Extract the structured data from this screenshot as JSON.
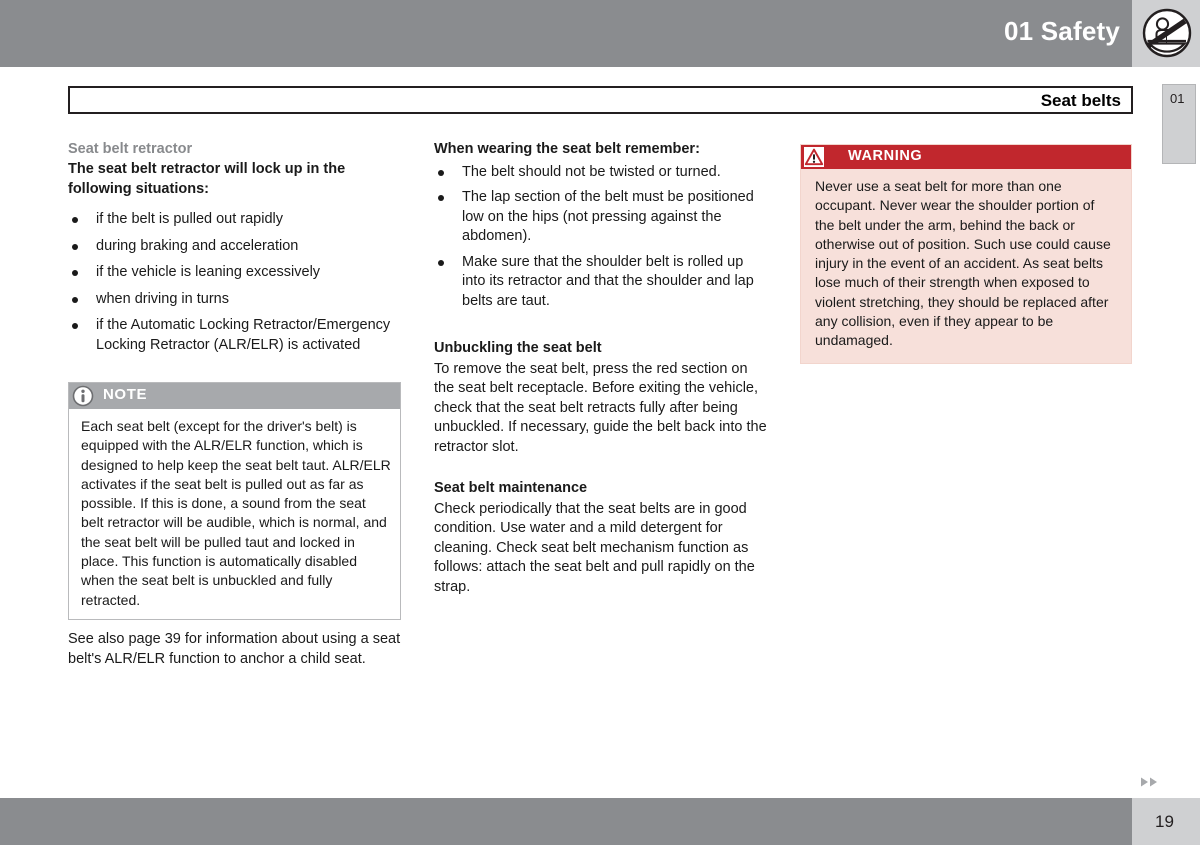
{
  "header": {
    "chapter_title": "01 Safety",
    "icon": "seat-belt-icon",
    "accent_gray": "#8a8c8f",
    "tab_gray": "#cfd0d2"
  },
  "section": {
    "title": "Seat belts",
    "chapter_tab": "01"
  },
  "columns": {
    "left": {
      "sub_heading": "Seat belt retractor",
      "lead": "The seat belt retractor will lock up in the following situations:",
      "bullets": [
        "if the belt is pulled out rapidly",
        "during braking and acceleration",
        "if the vehicle is leaning excessively",
        "when driving in turns",
        "if the Automatic Locking Retractor/Emergency Locking Retractor (ALR/ELR) is activated"
      ],
      "after_note_text": "See also page 39 for information about using a seat belt's ALR/ELR function to anchor a child seat."
    },
    "middle": {
      "bullet_heading": "When wearing the seat belt remember:",
      "bullets": [
        "The belt should not be twisted or turned.",
        "The lap section of the belt must be positioned low on the hips (not pressing against the abdomen).",
        "Make sure that the shoulder belt is rolled up into its retractor and that the shoulder and lap belts are taut."
      ],
      "sections": [
        {
          "heading": "Unbuckling the seat belt",
          "body": "To remove the seat belt, press the red section on the seat belt receptacle. Before exiting the vehicle, check that the seat belt retracts fully after being unbuckled. If necessary, guide the belt back into the retractor slot."
        },
        {
          "heading": "Seat belt maintenance",
          "body": "Check periodically that the seat belts are in good condition. Use water and a mild detergent for cleaning. Check seat belt mechanism function as follows: attach the seat belt and pull rapidly on the strap."
        }
      ]
    }
  },
  "note_box": {
    "label": "NOTE",
    "icon": "info-icon",
    "header_color": "#a7a9ac",
    "body": "Each seat belt (except for the driver's belt) is equipped with the ALR/ELR function, which is designed to help keep the seat belt taut. ALR/ELR activates if the seat belt is pulled out as far as possible. If this is done, a sound from the seat belt retractor will be audible, which is normal, and the seat belt will be pulled taut and locked in place. This function is automatically disabled when the seat belt is unbuckled and fully retracted."
  },
  "warning_box": {
    "label": "WARNING",
    "icon": "warning-triangle-icon",
    "header_color": "#c1272d",
    "background_color": "#f7e0da",
    "body": "Never use a seat belt for more than one occupant. Never wear the shoulder portion of the belt under the arm, behind the back or otherwise out of position. Such use could cause injury in the event of an accident. As seat belts lose much of their strength when exposed to violent stretching, they should be replaced after any collision, even if they appear to be undamaged."
  },
  "footer": {
    "page_number": "19",
    "arrows_icon": "double-chevron-right-icon"
  }
}
